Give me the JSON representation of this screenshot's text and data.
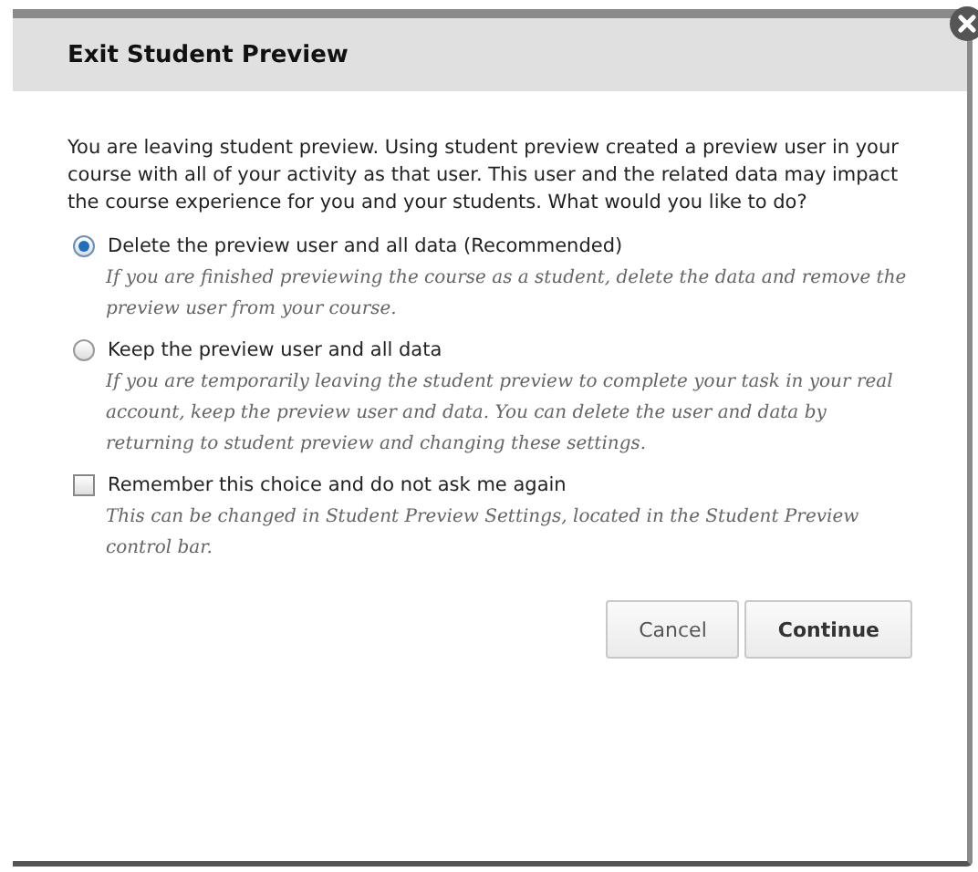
{
  "dialog": {
    "title": "Exit Student Preview",
    "intro": "You are leaving student preview. Using student preview created a preview user in your course with all of your activity as that user. This user and the related data may impact the course experience for you and your students. What would you like to do?",
    "options": [
      {
        "kind": "radio",
        "label": "Delete the preview user and all data (Recommended)",
        "description": "If you are finished previewing the course as a student, delete the data and remove the preview user from your course.",
        "selected": true
      },
      {
        "kind": "radio",
        "label": "Keep the preview user and all data",
        "description": "If you are temporarily leaving the student preview to complete your task in your real account, keep the preview user and data. You can delete the user and data by returning to student preview and changing these settings.",
        "selected": false
      },
      {
        "kind": "checkbox",
        "label": "Remember this choice and do not ask me again",
        "description": "This can be changed in Student Preview Settings, located in the Student Preview control bar.",
        "checked": false
      }
    ],
    "buttons": [
      {
        "label": "Cancel",
        "primary": false
      },
      {
        "label": "Continue",
        "primary": true
      }
    ]
  }
}
